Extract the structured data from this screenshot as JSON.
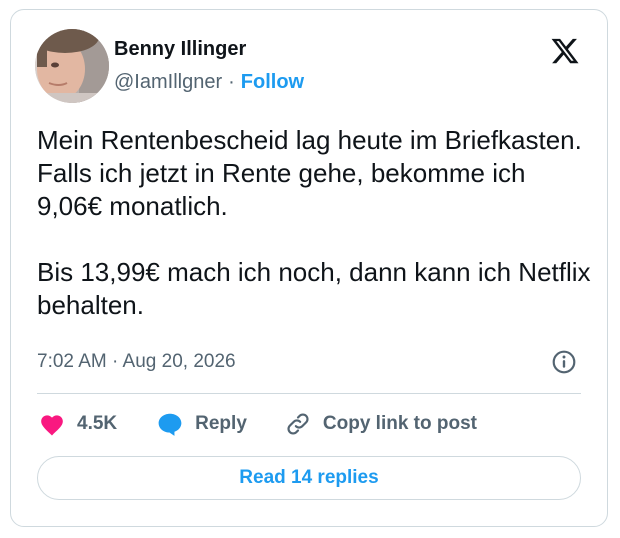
{
  "author": {
    "name": "Benny Illinger",
    "handle": "@IamIllgner",
    "separator": "·",
    "follow_label": "Follow"
  },
  "tweet": {
    "paragraphs": [
      "Mein Rentenbescheid lag heute im Briefkasten. Falls ich jetzt in Rente gehe, bekomme ich 9,06€ monatlich.",
      "Bis 13,99€ mach ich noch, dann kann ich Netflix behalten."
    ],
    "timestamp": "7:02 AM · Aug 20, 2026"
  },
  "actions": {
    "like_count": "4.5K",
    "reply_label": "Reply",
    "copy_label": "Copy link to post"
  },
  "read_replies_label": "Read 14 replies",
  "icons": {
    "brand": "x-logo-icon",
    "info": "info-icon",
    "like": "heart-icon",
    "reply": "speech-bubble-icon",
    "copy": "link-icon"
  },
  "colors": {
    "accent": "#1d9bf0",
    "like": "#f91880",
    "text": "#0f1419",
    "muted": "#536471",
    "border": "#cfd9de"
  }
}
